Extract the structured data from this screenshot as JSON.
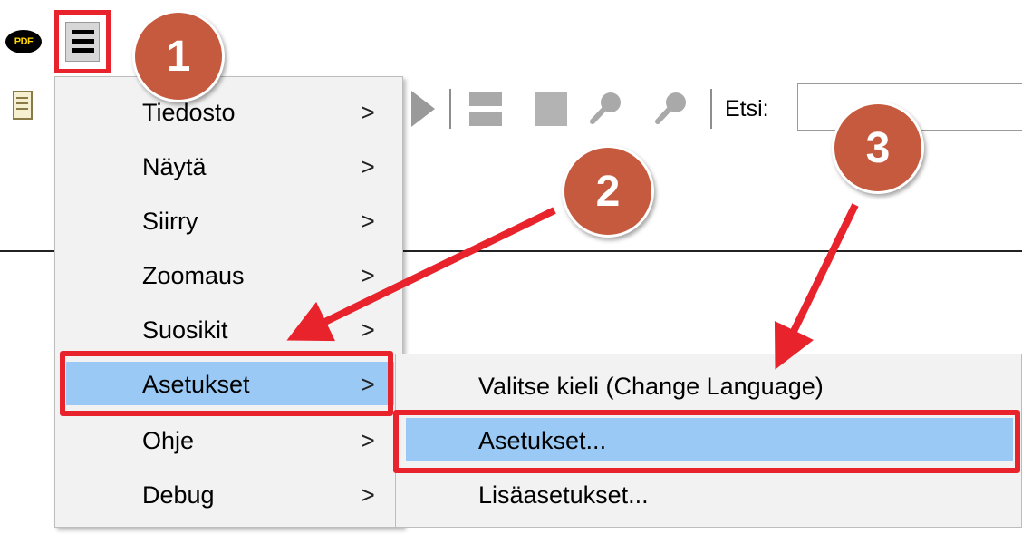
{
  "app": {
    "logo_text": "PDF",
    "logo_color": "#ffd400"
  },
  "toolbar": {
    "menu_icon": "hamburger-icon",
    "search_label": "Etsi:",
    "search_value": ""
  },
  "menu": {
    "items": [
      {
        "label": "Tiedosto",
        "arrow": ">"
      },
      {
        "label": "Näytä",
        "arrow": ">"
      },
      {
        "label": "Siirry",
        "arrow": ">"
      },
      {
        "label": "Zoomaus",
        "arrow": ">"
      },
      {
        "label": "Suosikit",
        "arrow": ">"
      },
      {
        "label": "Asetukset",
        "arrow": ">",
        "active": true
      },
      {
        "label": "Ohje",
        "arrow": ">"
      },
      {
        "label": "Debug",
        "arrow": ">"
      }
    ]
  },
  "submenu": {
    "items": [
      {
        "label": "Valitse kieli (Change Language)"
      },
      {
        "label": "Asetukset...",
        "active": true
      },
      {
        "label": "Lisäasetukset..."
      }
    ]
  },
  "annotations": {
    "badges": [
      "1",
      "2",
      "3"
    ],
    "highlight_color": "#e8232c",
    "badge_color": "#c55a3e",
    "selection_color": "#99c9f4"
  }
}
